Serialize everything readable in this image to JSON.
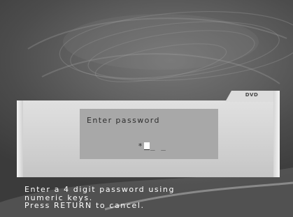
{
  "screen": {
    "dvd_label": "DVD"
  },
  "dialog": {
    "title": "Enter password",
    "password_entered": "*",
    "password_remaining": "_ _",
    "password_length": 4
  },
  "help": {
    "lines": [
      "Enter a 4 digit password using",
      "numeric keys.",
      "Press RETURN to cancel."
    ]
  },
  "colors": {
    "background": "#5a5a5a",
    "panel": "#d6d6d6",
    "dialog": "#a8a8a8",
    "help_text": "#ffffff"
  }
}
